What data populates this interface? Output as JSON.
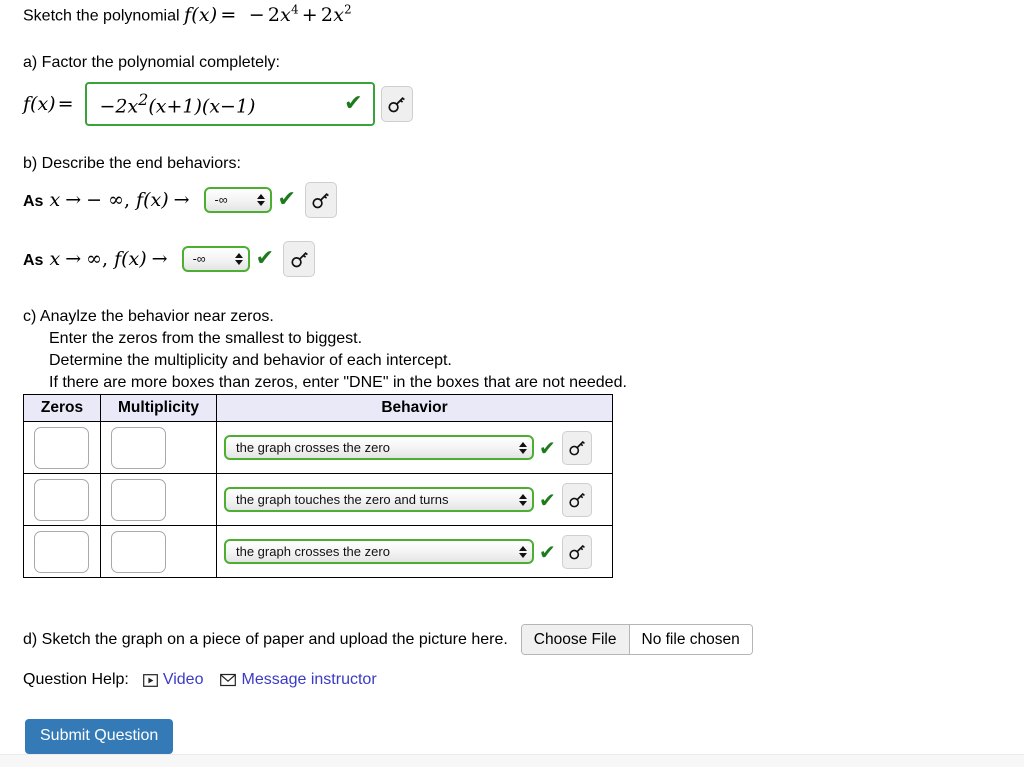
{
  "prompt": {
    "lead": "Sketch the polynomial",
    "fx": "f(x)",
    "equals": "=",
    "poly_coef1": "2",
    "poly_exp1": "4",
    "poly_plus": "+",
    "poly_coef2": "2",
    "poly_exp2": "2",
    "poly_var": "x",
    "minus": "−"
  },
  "parts": {
    "a": {
      "label": "a) Factor the polynomial completely:",
      "fx_label": "f(x)",
      "equals": "=",
      "answer": "−2x²(x + 1)(x − 1)",
      "answer_coef": "2",
      "answer_exp": "2",
      "check_mark": "✔",
      "key_icon": "key-icon"
    },
    "b": {
      "label": "b) Describe the end behaviors:",
      "rows": [
        {
          "text_as": "As",
          "text_x": "x",
          "arrow": "→",
          "limit": "− ∞",
          "comma_fx": "f(x)",
          "arrow2": "→",
          "selected": "-∞",
          "check_mark": "✔"
        },
        {
          "text_as": "As",
          "text_x": "x",
          "arrow": "→",
          "limit": "∞",
          "comma_fx": "f(x)",
          "arrow2": "→",
          "selected": "-∞",
          "check_mark": "✔"
        }
      ]
    },
    "c": {
      "label": "c) Anaylze the behavior near zeros.",
      "line2": "Enter the zeros from the smallest to biggest.",
      "line3": "Determine the multiplicity and behavior of each intercept.",
      "line4": "If there are more boxes than zeros, enter \"DNE\" in the boxes that are not needed.",
      "table": {
        "headers": [
          "Zeros",
          "Multiplicity",
          "Behavior"
        ],
        "rows": [
          {
            "zero": "",
            "multiplicity": "",
            "behavior": "the graph crosses the zero",
            "check_mark": "✔"
          },
          {
            "zero": "",
            "multiplicity": "",
            "behavior": "the graph touches the zero and turns",
            "check_mark": "✔"
          },
          {
            "zero": "",
            "multiplicity": "",
            "behavior": "the graph crosses the zero",
            "check_mark": "✔"
          }
        ],
        "header_bg": "#e9e9f8"
      }
    },
    "d": {
      "label": "d) Sketch the graph on a piece of paper and upload the picture here.",
      "choose_file_label": "Choose File",
      "file_status": "No file chosen"
    }
  },
  "question_help": {
    "label": "Question Help:",
    "video_label": "Video",
    "video_icon": "play-box-icon",
    "message_label": "Message instructor",
    "message_icon": "envelope-icon",
    "link_color": "#3a3ac8"
  },
  "submit": {
    "label": "Submit Question",
    "color": "#337ab7"
  },
  "colors": {
    "valid_green": "#4caf32",
    "check_green": "#1d7a1d",
    "answer_border": "#3aa23a"
  }
}
